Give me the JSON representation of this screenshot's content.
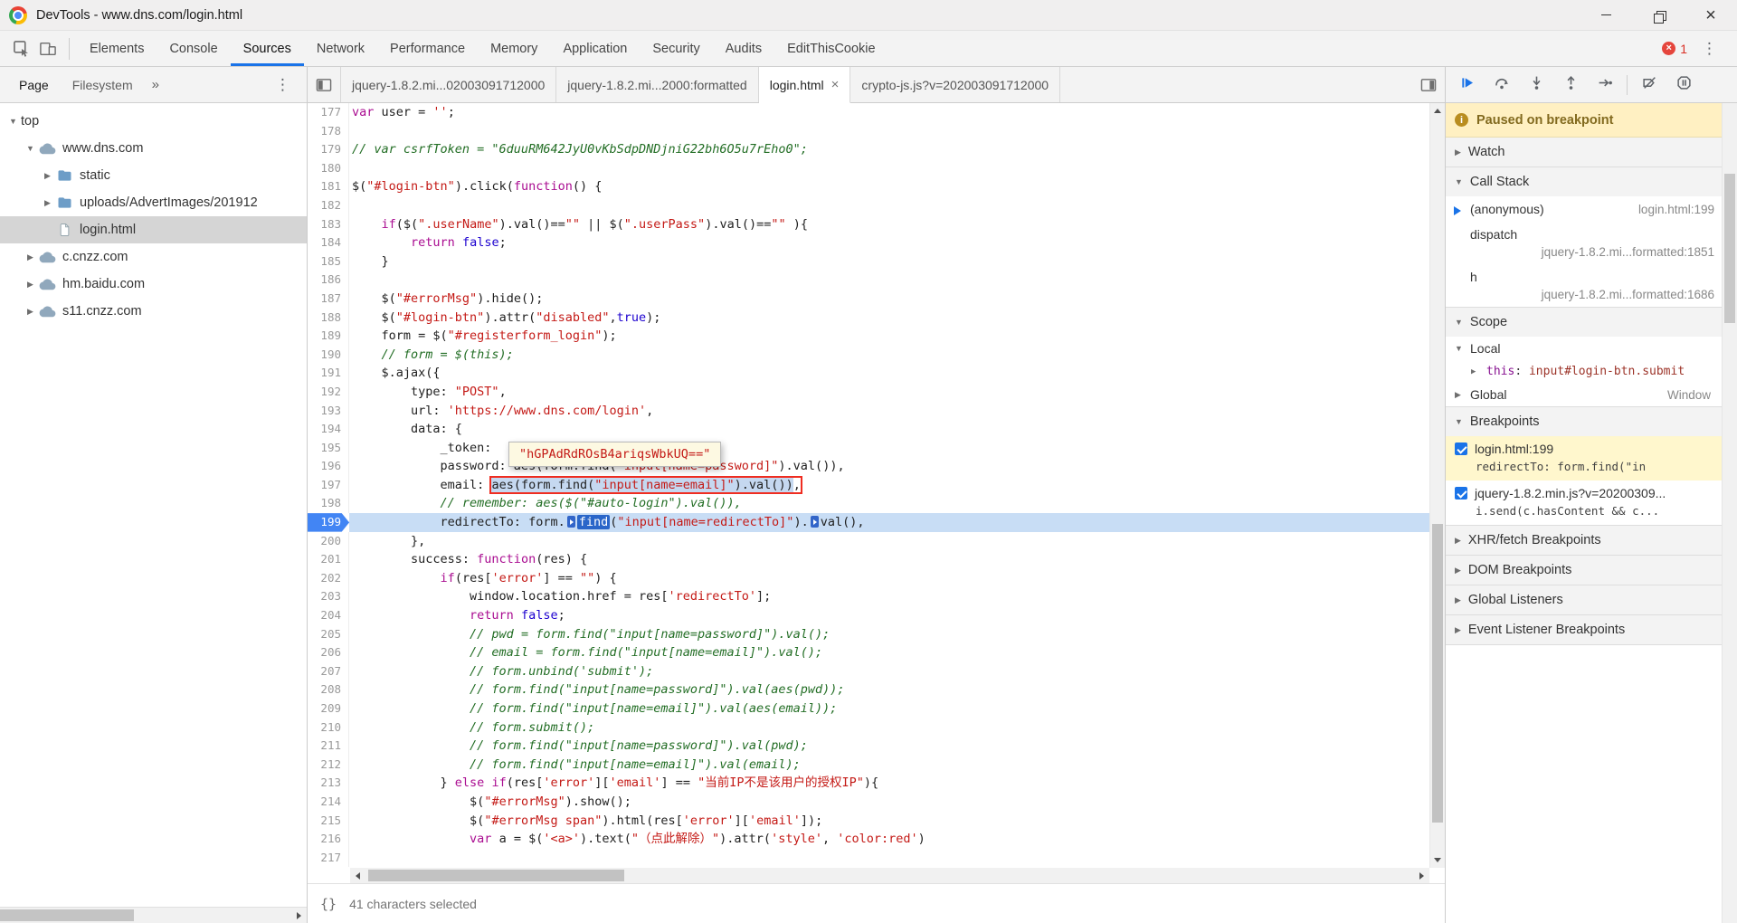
{
  "colors": {
    "accent_blue": "#1a73e8",
    "breakpoint_blue": "#4285f4",
    "exec_line_bg": "#c8ddf5",
    "selection_bg": "#c5d8f0",
    "error_red": "#d93025",
    "string_red": "#c41a16",
    "keyword_purple": "#aa0d91",
    "comment_green": "#236e25",
    "atom_blue": "#1c00cf",
    "paused_banner_bg": "#fff0c2",
    "active_breakpoint_bg": "#fff7cd"
  },
  "glyphs": {
    "expanded": "▼",
    "collapsed": "▶",
    "close": "×",
    "info": "i"
  },
  "titlebar": {
    "title": "DevTools - www.dns.com/login.html"
  },
  "toolbar": {
    "tabs": [
      {
        "label": "Elements"
      },
      {
        "label": "Console"
      },
      {
        "label": "Sources",
        "active": true
      },
      {
        "label": "Network"
      },
      {
        "label": "Performance"
      },
      {
        "label": "Memory"
      },
      {
        "label": "Application"
      },
      {
        "label": "Security"
      },
      {
        "label": "Audits"
      },
      {
        "label": "EditThisCookie"
      }
    ],
    "error_count": "1",
    "menu_glyph": "⋮"
  },
  "navigator": {
    "tabs": [
      {
        "label": "Page",
        "active": true
      },
      {
        "label": "Filesystem"
      }
    ],
    "overflow_glyph": "»",
    "menu_glyph": "⋮",
    "tree": [
      {
        "label": "top",
        "depth": 0,
        "expander": "▼",
        "icon": null
      },
      {
        "label": "www.dns.com",
        "depth": 1,
        "expander": "▼",
        "icon": "cloud"
      },
      {
        "label": "static",
        "depth": 2,
        "expander": "▶",
        "icon": "folder"
      },
      {
        "label": "uploads/AdvertImages/201912",
        "depth": 2,
        "expander": "▶",
        "icon": "folder"
      },
      {
        "label": "login.html",
        "depth": 2,
        "expander": "",
        "icon": "file",
        "selected": true
      },
      {
        "label": "c.cnzz.com",
        "depth": 1,
        "expander": "▶",
        "icon": "cloud"
      },
      {
        "label": "hm.baidu.com",
        "depth": 1,
        "expander": "▶",
        "icon": "cloud"
      },
      {
        "label": "s11.cnzz.com",
        "depth": 1,
        "expander": "▶",
        "icon": "cloud"
      }
    ]
  },
  "editor": {
    "tabs": [
      {
        "label": "jquery-1.8.2.mi...02003091712000"
      },
      {
        "label": "jquery-1.8.2.mi...2000:formatted"
      },
      {
        "label": "login.html",
        "active": true,
        "close_glyph": "×"
      },
      {
        "label": "crypto-js.js?v=202003091712000"
      }
    ],
    "tooltip": {
      "text": "\"hGPAdRdROsB4ariqsWbkUQ==\""
    },
    "lines": [
      {
        "n": 177,
        "seg": [
          {
            "c": "k",
            "t": "var"
          },
          {
            "c": "p",
            "t": " user = "
          },
          {
            "c": "s",
            "t": "''"
          },
          {
            "c": "p",
            "t": ";"
          }
        ]
      },
      {
        "n": 178,
        "seg": []
      },
      {
        "n": 179,
        "seg": [
          {
            "c": "c",
            "t": "// var csrfToken = \"6duuRM642JyU0vKbSdpDNDjniG22bh6O5u7rEho0\";"
          }
        ]
      },
      {
        "n": 180,
        "seg": []
      },
      {
        "n": 181,
        "seg": [
          {
            "c": "p",
            "t": "$("
          },
          {
            "c": "s",
            "t": "\"#login-btn\""
          },
          {
            "c": "p",
            "t": ").click("
          },
          {
            "c": "k",
            "t": "function"
          },
          {
            "c": "p",
            "t": "() {"
          }
        ]
      },
      {
        "n": 182,
        "seg": []
      },
      {
        "n": 183,
        "seg": [
          {
            "c": "p",
            "t": "    "
          },
          {
            "c": "k",
            "t": "if"
          },
          {
            "c": "p",
            "t": "($("
          },
          {
            "c": "s",
            "t": "\".userName\""
          },
          {
            "c": "p",
            "t": ").val()=="
          },
          {
            "c": "s",
            "t": "\"\""
          },
          {
            "c": "p",
            "t": " || $("
          },
          {
            "c": "s",
            "t": "\".userPass\""
          },
          {
            "c": "p",
            "t": ").val()=="
          },
          {
            "c": "s",
            "t": "\"\""
          },
          {
            "c": "p",
            "t": " ){"
          }
        ]
      },
      {
        "n": 184,
        "seg": [
          {
            "c": "p",
            "t": "        "
          },
          {
            "c": "k",
            "t": "return"
          },
          {
            "c": "p",
            "t": " "
          },
          {
            "c": "a",
            "t": "false"
          },
          {
            "c": "p",
            "t": ";"
          }
        ]
      },
      {
        "n": 185,
        "seg": [
          {
            "c": "p",
            "t": "    }"
          }
        ]
      },
      {
        "n": 186,
        "seg": []
      },
      {
        "n": 187,
        "seg": [
          {
            "c": "p",
            "t": "    $("
          },
          {
            "c": "s",
            "t": "\"#errorMsg\""
          },
          {
            "c": "p",
            "t": ").hide();"
          }
        ]
      },
      {
        "n": 188,
        "seg": [
          {
            "c": "p",
            "t": "    $("
          },
          {
            "c": "s",
            "t": "\"#login-btn\""
          },
          {
            "c": "p",
            "t": ").attr("
          },
          {
            "c": "s",
            "t": "\"disabled\""
          },
          {
            "c": "p",
            "t": ","
          },
          {
            "c": "a",
            "t": "true"
          },
          {
            "c": "p",
            "t": ");"
          }
        ]
      },
      {
        "n": 189,
        "seg": [
          {
            "c": "p",
            "t": "    form = $("
          },
          {
            "c": "s",
            "t": "\"#registerform_login\""
          },
          {
            "c": "p",
            "t": ");"
          }
        ]
      },
      {
        "n": 190,
        "seg": [
          {
            "c": "p",
            "t": "    "
          },
          {
            "c": "c",
            "t": "// form = $(this);"
          }
        ]
      },
      {
        "n": 191,
        "seg": [
          {
            "c": "p",
            "t": "    $.ajax({"
          }
        ]
      },
      {
        "n": 192,
        "seg": [
          {
            "c": "p",
            "t": "        type: "
          },
          {
            "c": "s",
            "t": "\"POST\""
          },
          {
            "c": "p",
            "t": ","
          }
        ]
      },
      {
        "n": 193,
        "seg": [
          {
            "c": "p",
            "t": "        url: "
          },
          {
            "c": "s",
            "t": "'https://www.dns.com/login'"
          },
          {
            "c": "p",
            "t": ","
          }
        ]
      },
      {
        "n": 194,
        "seg": [
          {
            "c": "p",
            "t": "        data: {"
          }
        ]
      },
      {
        "n": 195,
        "seg": [
          {
            "c": "p",
            "t": "            _token: "
          }
        ]
      },
      {
        "n": 196,
        "seg": [
          {
            "c": "p",
            "t": "            password: aes(form.find("
          },
          {
            "c": "s",
            "t": "\"input[name=password]\""
          },
          {
            "c": "p",
            "t": ").val()),"
          }
        ]
      },
      {
        "n": 197,
        "seg": [
          {
            "c": "p",
            "t": "            email: "
          },
          {
            "box": [
              {
                "c": "p",
                "sel": 1,
                "t": "aes(form.find("
              },
              {
                "c": "s",
                "sel": 1,
                "t": "\"input[name=email]\""
              },
              {
                "c": "p",
                "sel": 1,
                "t": ").val())"
              },
              {
                "c": "p",
                "t": ","
              }
            ]
          }
        ]
      },
      {
        "n": 198,
        "seg": [
          {
            "c": "p",
            "t": "            "
          },
          {
            "c": "c",
            "t": "// remember: aes($(\"#auto-login\").val()),"
          }
        ]
      },
      {
        "n": 199,
        "exec": true,
        "bp": true,
        "seg": [
          {
            "c": "p",
            "t": "            redirectTo: form."
          },
          {
            "m": 1
          },
          {
            "c": "x",
            "t": "find"
          },
          {
            "c": "p",
            "t": "("
          },
          {
            "c": "s",
            "t": "\"input[name=redirectTo]\""
          },
          {
            "c": "p",
            "t": ")."
          },
          {
            "m": 1
          },
          {
            "c": "p",
            "t": "val(),"
          }
        ]
      },
      {
        "n": 200,
        "seg": [
          {
            "c": "p",
            "t": "        },"
          }
        ]
      },
      {
        "n": 201,
        "seg": [
          {
            "c": "p",
            "t": "        success: "
          },
          {
            "c": "k",
            "t": "function"
          },
          {
            "c": "p",
            "t": "(res) {"
          }
        ]
      },
      {
        "n": 202,
        "seg": [
          {
            "c": "p",
            "t": "            "
          },
          {
            "c": "k",
            "t": "if"
          },
          {
            "c": "p",
            "t": "(res["
          },
          {
            "c": "s",
            "t": "'error'"
          },
          {
            "c": "p",
            "t": "] == "
          },
          {
            "c": "s",
            "t": "\"\""
          },
          {
            "c": "p",
            "t": ") {"
          }
        ]
      },
      {
        "n": 203,
        "seg": [
          {
            "c": "p",
            "t": "                window.location.href = res["
          },
          {
            "c": "s",
            "t": "'redirectTo'"
          },
          {
            "c": "p",
            "t": "];"
          }
        ]
      },
      {
        "n": 204,
        "seg": [
          {
            "c": "p",
            "t": "                "
          },
          {
            "c": "k",
            "t": "return"
          },
          {
            "c": "p",
            "t": " "
          },
          {
            "c": "a",
            "t": "false"
          },
          {
            "c": "p",
            "t": ";"
          }
        ]
      },
      {
        "n": 205,
        "seg": [
          {
            "c": "p",
            "t": "                "
          },
          {
            "c": "c",
            "t": "// pwd = form.find(\"input[name=password]\").val();"
          }
        ]
      },
      {
        "n": 206,
        "seg": [
          {
            "c": "p",
            "t": "                "
          },
          {
            "c": "c",
            "t": "// email = form.find(\"input[name=email]\").val();"
          }
        ]
      },
      {
        "n": 207,
        "seg": [
          {
            "c": "p",
            "t": "                "
          },
          {
            "c": "c",
            "t": "// form.unbind('submit');"
          }
        ]
      },
      {
        "n": 208,
        "seg": [
          {
            "c": "p",
            "t": "                "
          },
          {
            "c": "c",
            "t": "// form.find(\"input[name=password]\").val(aes(pwd));"
          }
        ]
      },
      {
        "n": 209,
        "seg": [
          {
            "c": "p",
            "t": "                "
          },
          {
            "c": "c",
            "t": "// form.find(\"input[name=email]\").val(aes(email));"
          }
        ]
      },
      {
        "n": 210,
        "seg": [
          {
            "c": "p",
            "t": "                "
          },
          {
            "c": "c",
            "t": "// form.submit();"
          }
        ]
      },
      {
        "n": 211,
        "seg": [
          {
            "c": "p",
            "t": "                "
          },
          {
            "c": "c",
            "t": "// form.find(\"input[name=password]\").val(pwd);"
          }
        ]
      },
      {
        "n": 212,
        "seg": [
          {
            "c": "p",
            "t": "                "
          },
          {
            "c": "c",
            "t": "// form.find(\"input[name=email]\").val(email);"
          }
        ]
      },
      {
        "n": 213,
        "seg": [
          {
            "c": "p",
            "t": "            } "
          },
          {
            "c": "k",
            "t": "else"
          },
          {
            "c": "p",
            "t": " "
          },
          {
            "c": "k",
            "t": "if"
          },
          {
            "c": "p",
            "t": "(res["
          },
          {
            "c": "s",
            "t": "'error'"
          },
          {
            "c": "p",
            "t": "]["
          },
          {
            "c": "s",
            "t": "'email'"
          },
          {
            "c": "p",
            "t": "] == "
          },
          {
            "c": "s",
            "t": "\"当前IP不是该用户的授权IP\""
          },
          {
            "c": "p",
            "t": "){"
          }
        ]
      },
      {
        "n": 214,
        "seg": [
          {
            "c": "p",
            "t": "                $("
          },
          {
            "c": "s",
            "t": "\"#errorMsg\""
          },
          {
            "c": "p",
            "t": ").show();"
          }
        ]
      },
      {
        "n": 215,
        "seg": [
          {
            "c": "p",
            "t": "                $("
          },
          {
            "c": "s",
            "t": "\"#errorMsg span\""
          },
          {
            "c": "p",
            "t": ").html(res["
          },
          {
            "c": "s",
            "t": "'error'"
          },
          {
            "c": "p",
            "t": "]["
          },
          {
            "c": "s",
            "t": "'email'"
          },
          {
            "c": "p",
            "t": "]);"
          }
        ]
      },
      {
        "n": 216,
        "seg": [
          {
            "c": "p",
            "t": "                "
          },
          {
            "c": "k",
            "t": "var"
          },
          {
            "c": "p",
            "t": " a = $("
          },
          {
            "c": "s",
            "t": "'<a>'"
          },
          {
            "c": "p",
            "t": ").text("
          },
          {
            "c": "s",
            "t": "\"（点此解除）\""
          },
          {
            "c": "p",
            "t": ").attr("
          },
          {
            "c": "s",
            "t": "'style'"
          },
          {
            "c": "p",
            "t": ", "
          },
          {
            "c": "s",
            "t": "'color:red'"
          },
          {
            "c": "p",
            "t": ")"
          }
        ]
      },
      {
        "n": 217,
        "seg": []
      }
    ]
  },
  "debugger_panel": {
    "toolbar_icons": [
      "resume",
      "step-over",
      "step-into",
      "step-out",
      "step",
      "deactivate-breakpoints",
      "pause-on-exceptions"
    ],
    "banner": {
      "text": "Paused on breakpoint"
    },
    "watch": {
      "label": "Watch"
    },
    "call_stack": {
      "label": "Call Stack",
      "frames": [
        {
          "name": "(anonymous)",
          "location": "login.html:199",
          "current": true
        },
        {
          "name": "dispatch",
          "location": "jquery-1.8.2.mi...formatted:1851",
          "wrap": true
        },
        {
          "name": "h",
          "location": "jquery-1.8.2.mi...formatted:1686",
          "wrap": true
        }
      ]
    },
    "scope": {
      "label": "Scope",
      "locals_label": "Local",
      "this_name": "this",
      "this_colon": ": ",
      "this_value": "input#login-btn.submit",
      "global_label": "Global",
      "global_value": "Window"
    },
    "breakpoints": {
      "label": "Breakpoints",
      "items": [
        {
          "label": "login.html:199",
          "snippet": "redirectTo: form.find(\"in",
          "checked": true,
          "active": true
        },
        {
          "label": "jquery-1.8.2.min.js?v=20200309...",
          "snippet": "i.send(c.hasContent && c...",
          "checked": true
        }
      ]
    },
    "collapsed_sections": [
      "XHR/fetch Breakpoints",
      "DOM Breakpoints",
      "Global Listeners",
      "Event Listener Breakpoints"
    ]
  },
  "statusbar": {
    "pretty_print_glyph": "{}",
    "text": "41 characters selected"
  }
}
